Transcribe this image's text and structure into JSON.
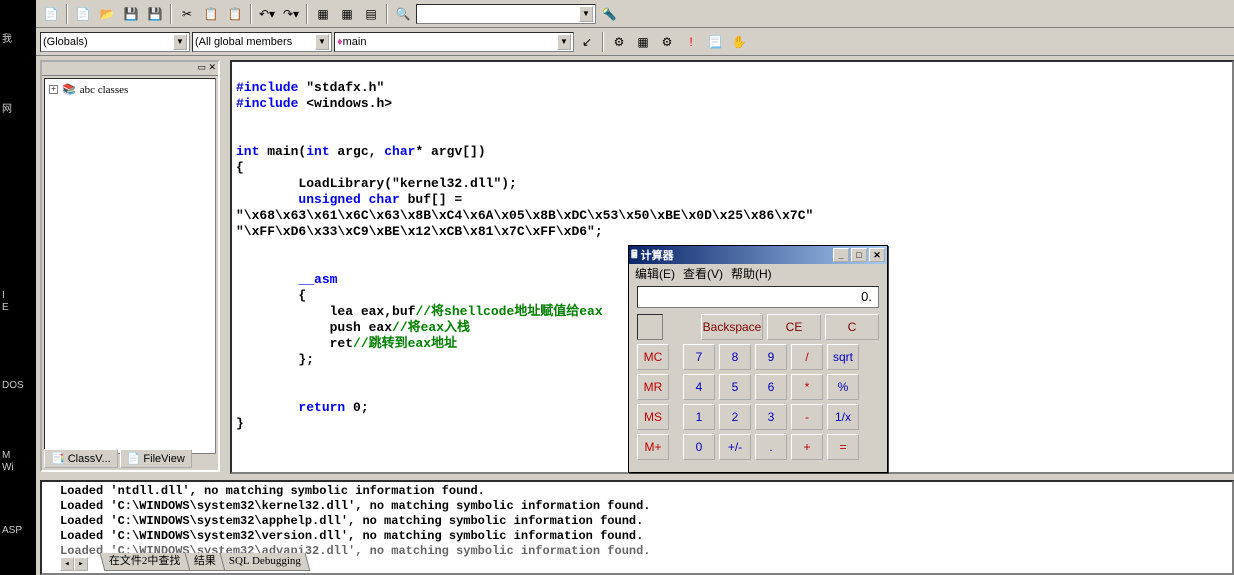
{
  "left_labels": {
    "l1": "我",
    "l2": "网",
    "l3": "I",
    "l4": "E",
    "l5": "DOS",
    "l6": "M",
    "l7": "Wi",
    "l8": "ASP"
  },
  "toolbar": {
    "combo_globals": "(Globals)",
    "combo_members": "(All global members",
    "combo_main": "main",
    "find_text": ""
  },
  "workspace": {
    "tree_item": "abc classes",
    "tab_class": "ClassV...",
    "tab_file": "FileView"
  },
  "code": {
    "inc1_kw": "#include",
    "inc1_s": "\"stdafx.h\"",
    "inc2_kw": "#include",
    "inc2_s": "<windows.h>",
    "int": "int",
    "main": " main(",
    "int2": "int",
    "argc": " argc, ",
    "char": "char",
    "argv": "* argv[])",
    "lb": "{",
    "load": "        LoadLibrary(\"kernel32.dll\");",
    "uns": "        unsigned char",
    "buf": " buf[] =",
    "hex1": "\"\\x68\\x63\\x61\\x6C\\x63\\x8B\\xC4\\x6A\\x05\\x8B\\xDC\\x53\\x50\\xBE\\x0D\\x25\\x86\\x7C\"",
    "hex2": "\"\\xFF\\xD6\\x33\\xC9\\xBE\\x12\\xCB\\x81\\x7C\\xFF\\xD6\";",
    "asm": "        __asm",
    "lb2": "        {",
    "lea": "            lea eax,buf",
    "lea_c": "//将shellcode地址赋值给eax",
    "push": "            push eax",
    "push_c": "//将eax入栈",
    "ret": "            ret",
    "ret_c": "//跳转到eax地址",
    "rb2": "        };",
    "return": "        return",
    "zero": " 0;",
    "rb": "}"
  },
  "output": {
    "l1": "Loaded 'ntdll.dll', no matching symbolic information found.",
    "l2": "Loaded 'C:\\WINDOWS\\system32\\kernel32.dll', no matching symbolic information found.",
    "l3": "Loaded 'C:\\WINDOWS\\system32\\apphelp.dll', no matching symbolic information found.",
    "l4": "Loaded 'C:\\WINDOWS\\system32\\version.dll', no matching symbolic information found.",
    "l5": "Loaded 'C:\\WINDOWS\\system32\\advapi32.dll', no matching symbolic information found.",
    "tab1": "在文件2中查找",
    "tab2": "结果",
    "tab3": "SQL Debugging"
  },
  "calc": {
    "title": "计算器",
    "menu_edit": "编辑(E)",
    "menu_view": "查看(V)",
    "menu_help": "帮助(H)",
    "display": "0.",
    "backspace": "Backspace",
    "ce": "CE",
    "c": "C",
    "mc": "MC",
    "mr": "MR",
    "ms": "MS",
    "mp": "M+",
    "n7": "7",
    "n8": "8",
    "n9": "9",
    "div": "/",
    "sqrt": "sqrt",
    "n4": "4",
    "n5": "5",
    "n6": "6",
    "mul": "*",
    "pct": "%",
    "n1": "1",
    "n2": "2",
    "n3": "3",
    "sub": "-",
    "inv": "1/x",
    "n0": "0",
    "pm": "+/-",
    "dot": ".",
    "add": "+",
    "eq": "="
  }
}
